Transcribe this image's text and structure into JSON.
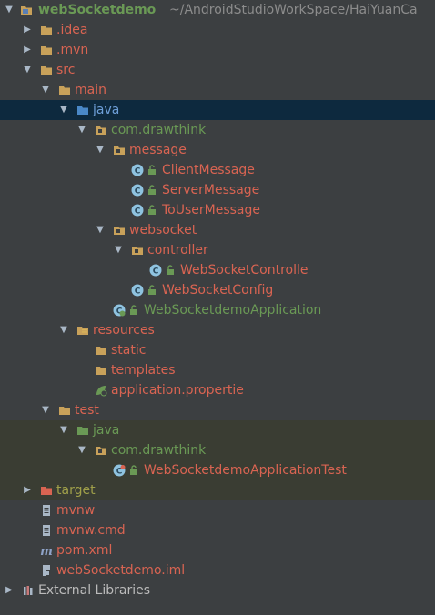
{
  "project": {
    "name": "webSocketdemo",
    "path": "~/AndroidStudioWorkSpace/HaiYuanCa"
  },
  "nodes": {
    "idea": ".idea",
    "mvn": ".mvn",
    "src": "src",
    "main": "main",
    "java_main": "java",
    "pkg_main": "com.drawthink",
    "message": "message",
    "client_message": "ClientMessage",
    "server_message": "ServerMessage",
    "touser_message": "ToUserMessage",
    "websocket": "websocket",
    "controller": "controller",
    "ws_controller": "WebSocketControlle",
    "ws_config": "WebSocketConfig",
    "app": "WebSocketdemoApplication",
    "resources": "resources",
    "static": "static",
    "templates": "templates",
    "app_props": "application.propertie",
    "test": "test",
    "java_test": "java",
    "pkg_test": "com.drawthink",
    "app_tests": "WebSocketdemoApplicationTest",
    "target": "target",
    "mvnw": "mvnw",
    "mvnw_cmd": "mvnw.cmd",
    "pom": "pom.xml",
    "iml": "webSocketdemo.iml",
    "external_libraries": "External Libraries"
  },
  "colors": {
    "background": "#3c3f41",
    "selected_row": "#0d293e",
    "test_rows": "#3a3d33",
    "modified_red": "#d96452",
    "added_green": "#6a9955",
    "folder": "#c8a15a",
    "class_icon": "#8fc3e0"
  }
}
